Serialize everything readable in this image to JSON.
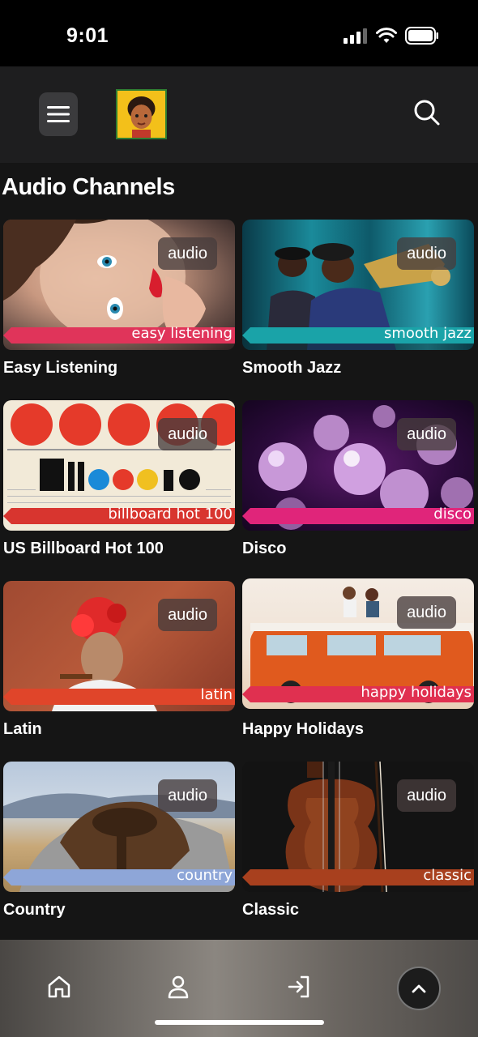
{
  "status_bar": {
    "time": "9:01"
  },
  "header": {
    "menu_icon": "hamburger-icon",
    "logo": "avatar-logo",
    "search_icon": "search-icon"
  },
  "section": {
    "title": "Audio Channels"
  },
  "channels": [
    {
      "title": "Easy Listening",
      "badge": "audio",
      "ribbon": "easy listening",
      "ribbon_color": "#e0345a"
    },
    {
      "title": "Smooth Jazz",
      "badge": "audio",
      "ribbon": "smooth jazz",
      "ribbon_color": "#1aa3a8"
    },
    {
      "title": "US Billboard Hot 100",
      "badge": "audio",
      "ribbon": "billboard hot 100",
      "ribbon_color": "#d8352f"
    },
    {
      "title": "Disco",
      "badge": "audio",
      "ribbon": "disco",
      "ribbon_color": "#e0257a"
    },
    {
      "title": "Latin",
      "badge": "audio",
      "ribbon": "latin",
      "ribbon_color": "#e0452a"
    },
    {
      "title": "Happy Holidays",
      "badge": "audio",
      "ribbon": "happy holidays",
      "ribbon_color": "#e03050"
    },
    {
      "title": "Country",
      "badge": "audio",
      "ribbon": "country",
      "ribbon_color": "#8ea6d8"
    },
    {
      "title": "Classic",
      "badge": "audio",
      "ribbon": "classic",
      "ribbon_color": "#a8401e"
    }
  ],
  "bottom_nav": {
    "items": [
      "home-icon",
      "user-icon",
      "login-icon"
    ],
    "scroll_top_icon": "chevron-up-icon"
  }
}
